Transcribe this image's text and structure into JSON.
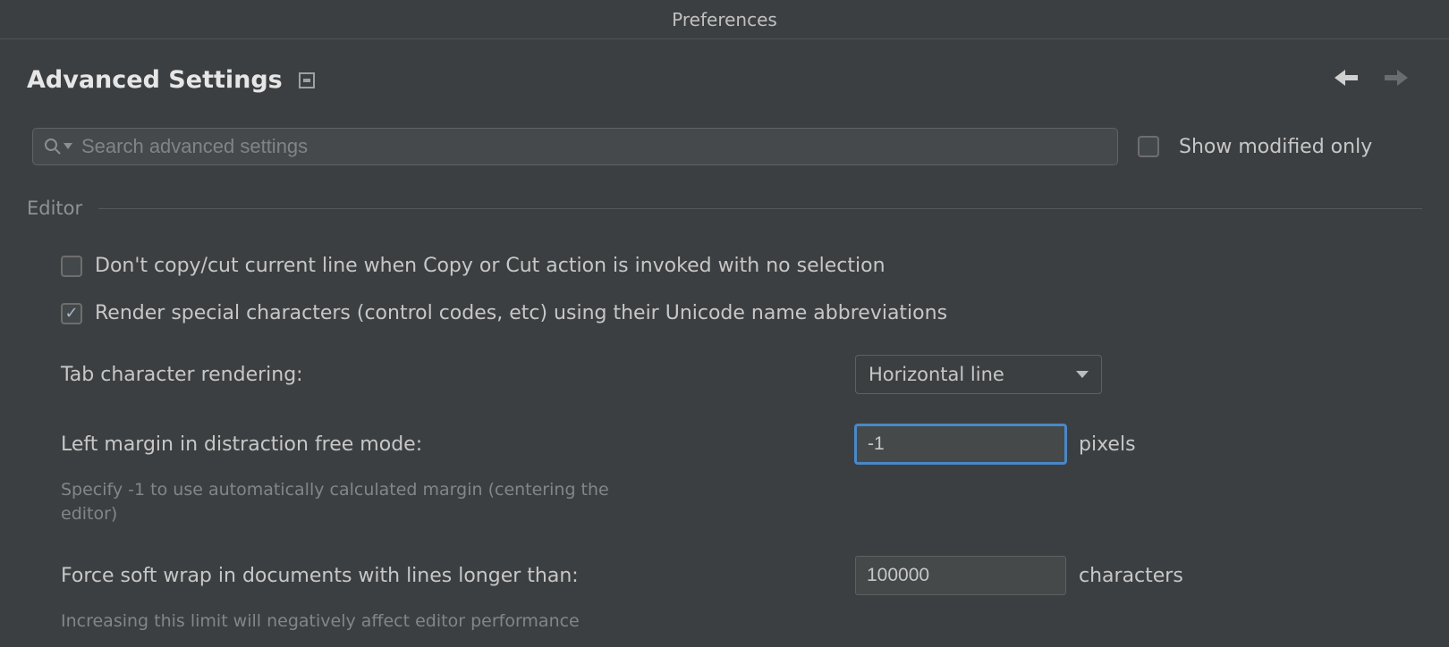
{
  "window": {
    "title": "Preferences"
  },
  "page": {
    "title": "Advanced Settings"
  },
  "search": {
    "placeholder": "Search advanced settings"
  },
  "show_modified": {
    "label": "Show modified only",
    "checked": false
  },
  "section": {
    "title": "Editor"
  },
  "options": {
    "no_copy_cut": {
      "label": "Don't copy/cut current line when Copy or Cut action is invoked with no selection",
      "checked": false
    },
    "render_special": {
      "label": "Render special characters (control codes, etc) using their Unicode name abbreviations",
      "checked": true
    },
    "tab_rendering": {
      "label": "Tab character rendering:",
      "value": "Horizontal line"
    },
    "left_margin": {
      "label": "Left margin in distraction free mode:",
      "value": "-1",
      "unit": "pixels",
      "help": "Specify -1 to use automatically calculated margin (centering the editor)"
    },
    "soft_wrap": {
      "label": "Force soft wrap in documents with lines longer than:",
      "value": "100000",
      "unit": "characters",
      "help": "Increasing this limit will negatively affect editor performance"
    }
  }
}
